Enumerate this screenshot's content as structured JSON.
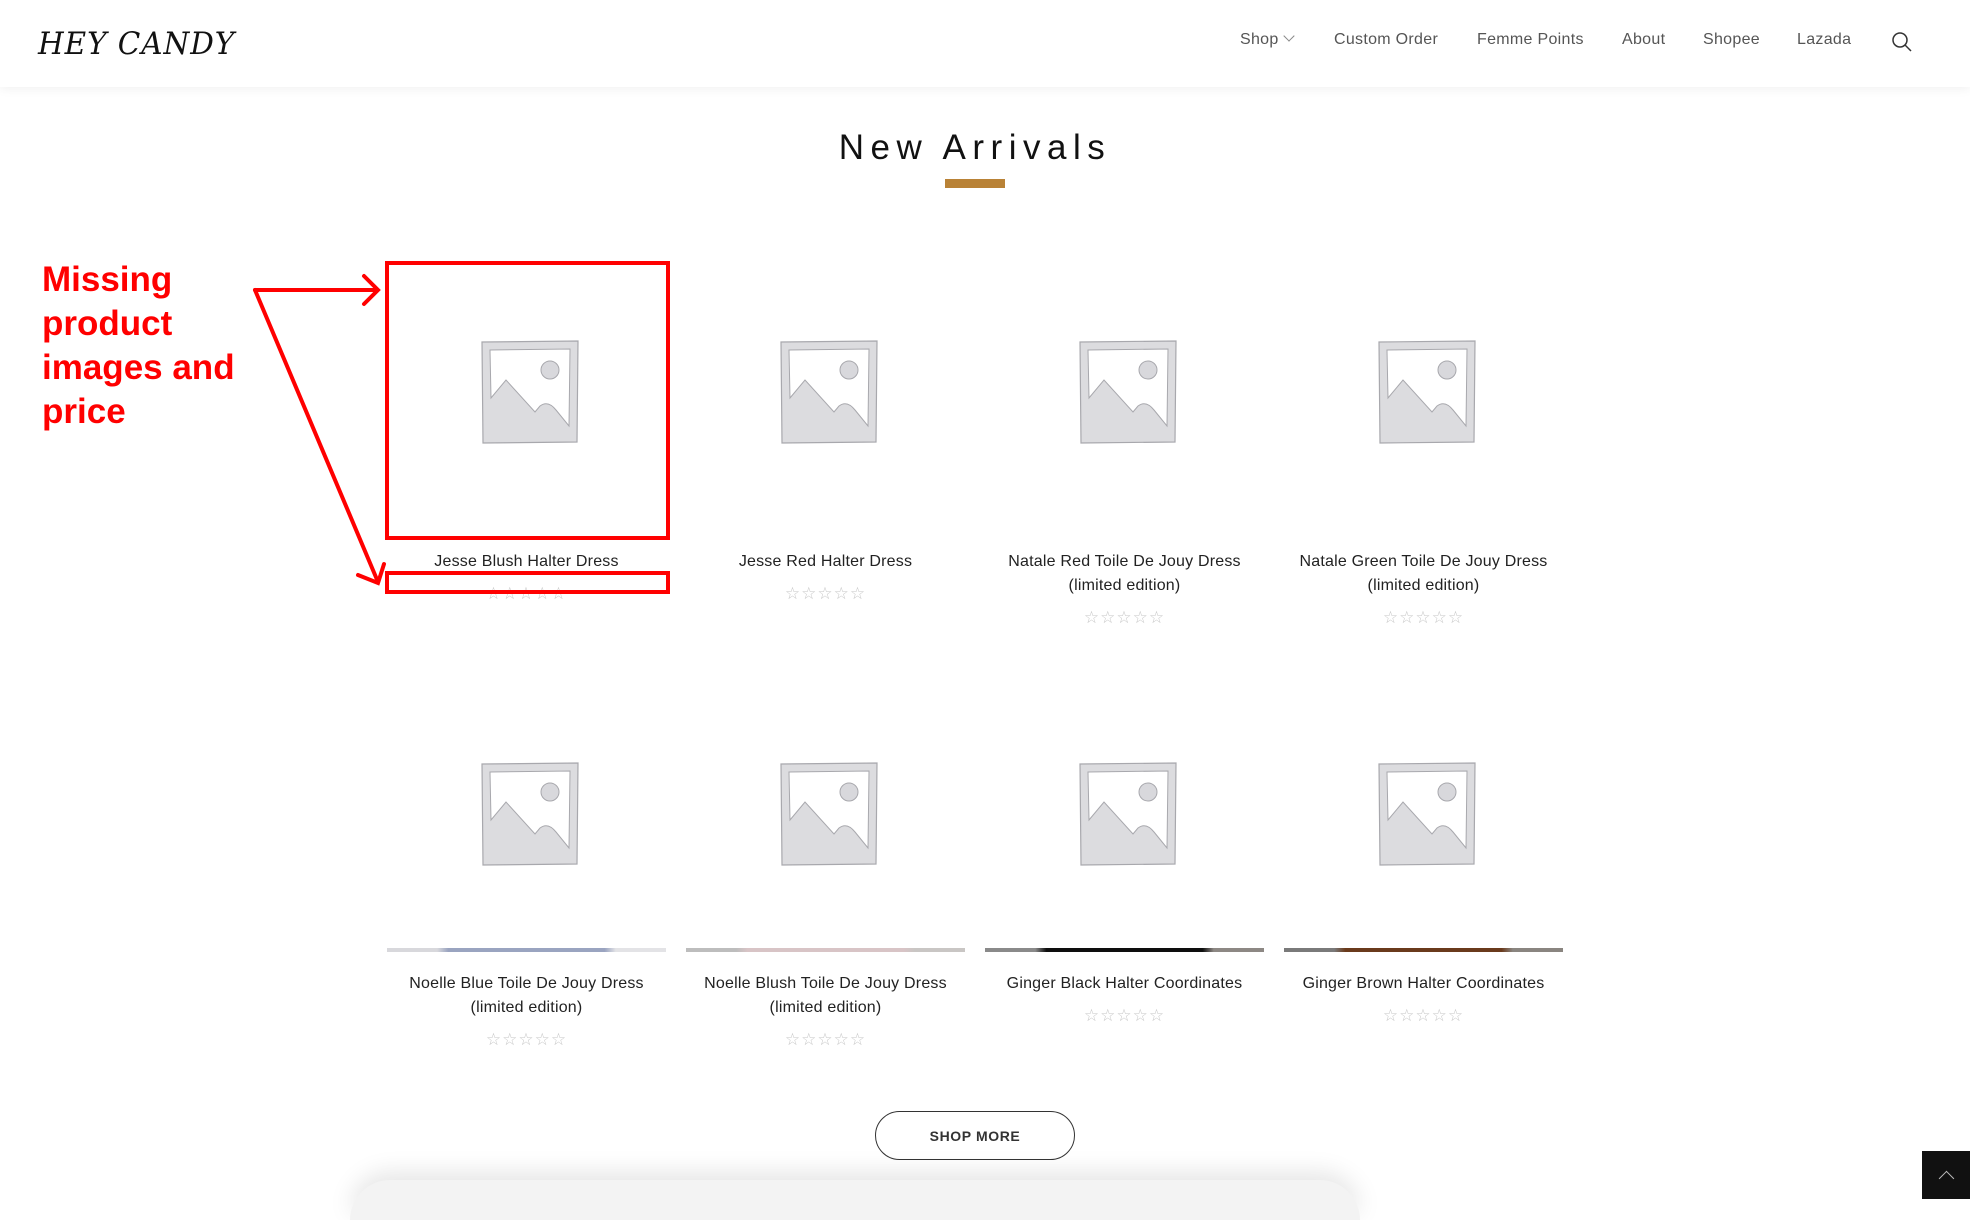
{
  "header": {
    "logo": "HEY CANDY",
    "nav": [
      {
        "label": "Shop",
        "has_dropdown": true
      },
      {
        "label": "Custom Order"
      },
      {
        "label": "Femme Points"
      },
      {
        "label": "About"
      },
      {
        "label": "Shopee"
      },
      {
        "label": "Lazada"
      }
    ],
    "search_icon": "search-icon"
  },
  "section": {
    "title": "New Arrivals",
    "accent_color": "#B98236"
  },
  "products": [
    {
      "title": "Jesse Blush Halter Dress",
      "rating": 0,
      "max_rating": 5,
      "image": "placeholder-image"
    },
    {
      "title": "Jesse Red Halter Dress",
      "rating": 0,
      "max_rating": 5,
      "image": "placeholder-image"
    },
    {
      "title": "Natale Red Toile De Jouy Dress (limited edition)",
      "rating": 0,
      "max_rating": 5,
      "image": "placeholder-image"
    },
    {
      "title": "Natale Green Toile De Jouy Dress (limited edition)",
      "rating": 0,
      "max_rating": 5,
      "image": "placeholder-image"
    },
    {
      "title": "Noelle Blue Toile De Jouy Dress (limited edition)",
      "rating": 0,
      "max_rating": 5,
      "image": "placeholder-image",
      "strip_colors": [
        "#d8d8dc",
        "#9aa4c0",
        "#e3e3e6"
      ]
    },
    {
      "title": "Noelle Blush Toile De Jouy Dress (limited edition)",
      "rating": 0,
      "max_rating": 5,
      "image": "placeholder-image",
      "strip_colors": [
        "#bdbdbd",
        "#d8c4c6",
        "#c9c6c4"
      ]
    },
    {
      "title": "Ginger Black Halter Coordinates",
      "rating": 0,
      "max_rating": 5,
      "image": "placeholder-image",
      "strip_colors": [
        "#8a8a8a",
        "#0e0e0e",
        "#8d8884"
      ]
    },
    {
      "title": "Ginger Brown Halter Coordinates",
      "rating": 0,
      "max_rating": 5,
      "image": "placeholder-image",
      "strip_colors": [
        "#7a7a7a",
        "#6a3a1c",
        "#8a8580"
      ]
    }
  ],
  "shop_more_label": "SHOP MORE",
  "scroll_top_icon": "chevron-up-icon",
  "annotation": {
    "text": "Missing product images and price",
    "color": "#ff0000"
  }
}
